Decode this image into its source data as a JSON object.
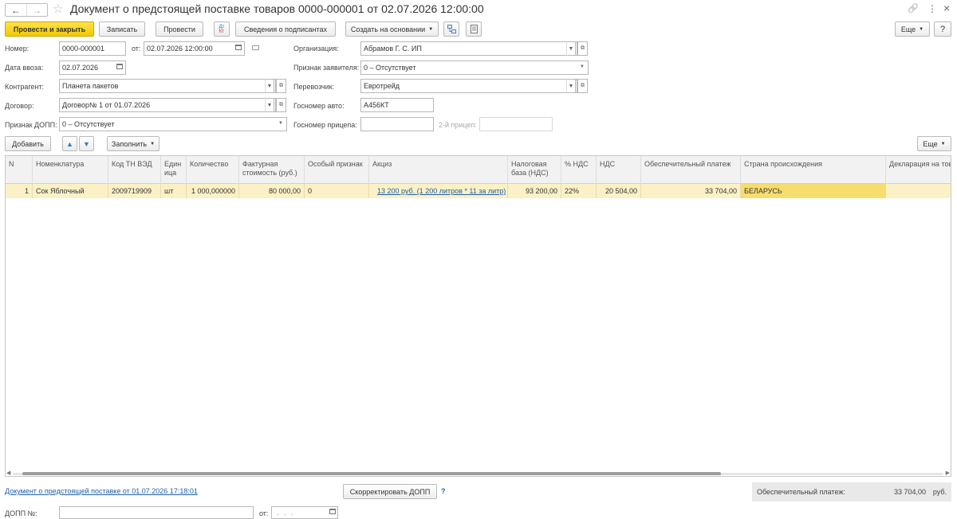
{
  "window": {
    "title": "Документ о предстоящей поставке товаров 0000-000001 от 02.07.2026 12:00:00",
    "back_icon": "←",
    "forward_icon": "→",
    "star_icon": "☆",
    "link_icon": "🔗",
    "more_icon": "⋮",
    "close_icon": "×"
  },
  "toolbar": {
    "post_close": "Провести и закрыть",
    "save": "Записать",
    "post": "Провести",
    "dtkt_top": "Дт",
    "dtkt_bottom": "Кт",
    "signers": "Сведения о подписантах",
    "create_based": "Создать на основании",
    "more": "Еще"
  },
  "form": {
    "number_label": "Номер:",
    "number_value": "0000-000001",
    "from_label": "от:",
    "date_value": "02.07.2026 12:00:00",
    "import_date_label": "Дата ввоза:",
    "import_date_value": "02.07.2026",
    "counterparty_label": "Контрагент:",
    "counterparty_value": "Планета пакетов",
    "contract_label": "Договор:",
    "contract_value": "Договор№ 1 от 01.07.2026",
    "dopp_sign_label": "Признак ДОПП:",
    "dopp_sign_value": "0 – Отсутствует",
    "org_label": "Организация:",
    "org_value": "Абрамов Г. С. ИП",
    "declarant_label": "Признак заявителя:",
    "declarant_value": "0 – Отсутствует",
    "carrier_label": "Перевозчик:",
    "carrier_value": "Евротрейд",
    "plate_label": "Госномер авто:",
    "plate_value": "А456КТ",
    "trailer_label": "Госномер прицепа:",
    "trailer_value": "",
    "trailer2_label": "2-й прицеп:",
    "trailer2_value": ""
  },
  "table_toolbar": {
    "add": "Добавить",
    "fill": "Заполнить",
    "more": "Еще"
  },
  "table": {
    "headers": [
      "N",
      "Номенклатура",
      "Код ТН ВЭД",
      "Един ица",
      "Количество",
      "Фактурная стоимость (руб.)",
      "Особый признак",
      "Акциз",
      "Налоговая база (НДС)",
      "% НДС",
      "НДС",
      "Обеспечительный платеж",
      "Страна происхождения",
      "Декларация на тов"
    ],
    "rows": [
      [
        "1",
        "Сок Яблочный",
        "2009719909",
        "шт",
        "1 000,000000",
        "80 000,00",
        "0",
        "13 200 руб. (1 200 литров * 11 за литр)",
        "93 200,00",
        "22%",
        "20 504,00",
        "33 704,00",
        "БЕЛАРУСЬ",
        ""
      ]
    ]
  },
  "footer": {
    "link": "Документ о предстоящей поставке от 01.07.2026 17:18:01",
    "correct_btn": "Скорректировать ДОПП",
    "question": "?",
    "total_label": "Обеспечительный платеж:",
    "total_value": "33 704,00",
    "total_unit": "руб.",
    "dopp_no_label": "ДОПП №:",
    "dopp_no_value": "",
    "dopp_from_label": "от:",
    "dopp_from_value": ". . ."
  },
  "colors": {
    "primary_button": "#f2c800",
    "selected_row": "#fbf1c6",
    "selected_cell": "#f7dd6e",
    "link": "#1f5fa8"
  }
}
